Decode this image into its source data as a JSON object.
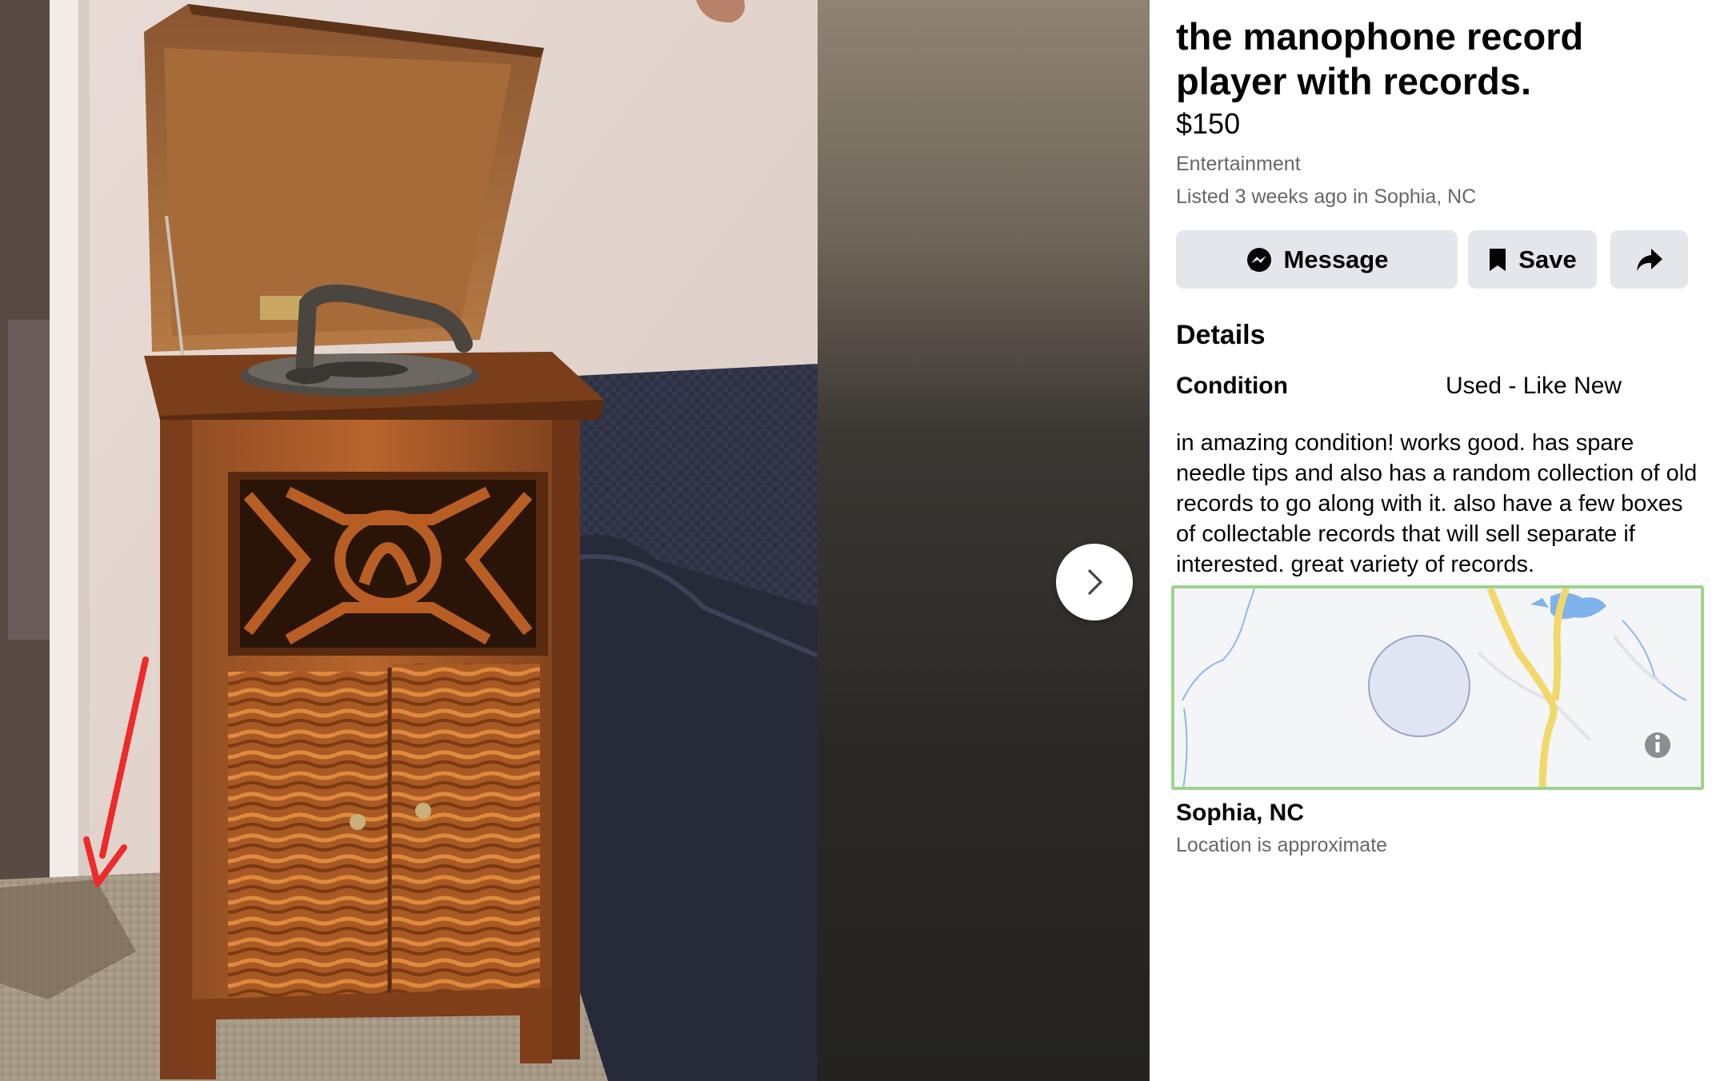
{
  "listing": {
    "title": "the manophone record player with records.",
    "price": "$150",
    "category": "Entertainment",
    "listed": "Listed 3 weeks ago in Sophia, NC"
  },
  "actions": {
    "message_label": "Message",
    "save_label": "Save"
  },
  "details": {
    "heading": "Details",
    "condition_label": "Condition",
    "condition_value": "Used - Like New",
    "description": "in amazing condition! works good. has spare needle tips and also has a random collection of old records to go along with it. also have a few boxes of collectable records that will sell separate if interested. great variety of records."
  },
  "location": {
    "name": "Sophia, NC",
    "note": "Location is approximate"
  },
  "icons": {
    "next": "chevron-right-icon",
    "message": "messenger-icon",
    "save": "bookmark-icon",
    "share": "share-arrow-icon",
    "map_info": "info-icon"
  },
  "colors": {
    "button_bg": "#e4e6eb",
    "secondary_text": "#65676b",
    "map_border": "#9dd48f",
    "road": "#f2d86a",
    "water": "#7fb3ec"
  }
}
